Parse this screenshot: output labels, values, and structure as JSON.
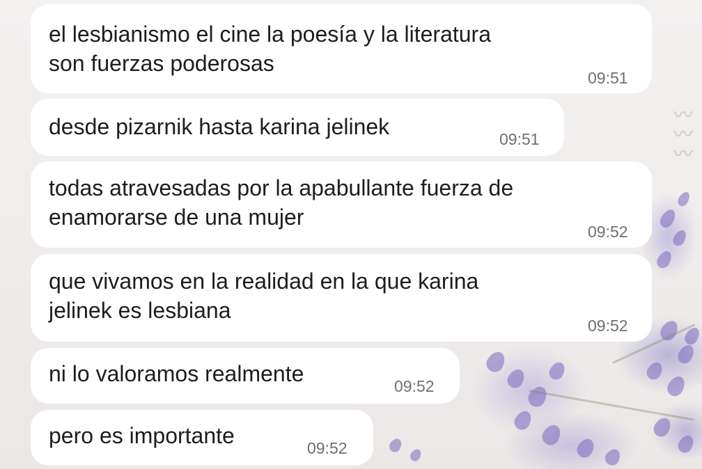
{
  "messages": [
    {
      "lines": [
        "el lesbianismo el cine la poesía y la literatura",
        "son fuerzas poderosas"
      ],
      "time": "09:51"
    },
    {
      "lines": [
        "desde pizarnik hasta karina jelinek"
      ],
      "time": "09:51"
    },
    {
      "lines": [
        "todas atravesadas por la apabullante fuerza de",
        "enamorarse de una mujer"
      ],
      "time": "09:52"
    },
    {
      "lines": [
        "que vivamos en la realidad en la que karina",
        "jelinek es lesbiana"
      ],
      "time": "09:52"
    },
    {
      "lines": [
        "ni lo valoramos realmente"
      ],
      "time": "09:52"
    },
    {
      "lines": [
        "pero es importante"
      ],
      "time": "09:52"
    }
  ],
  "wallpaper": {
    "accent_color": "#7a69be",
    "motif": "lavender-flowers"
  }
}
